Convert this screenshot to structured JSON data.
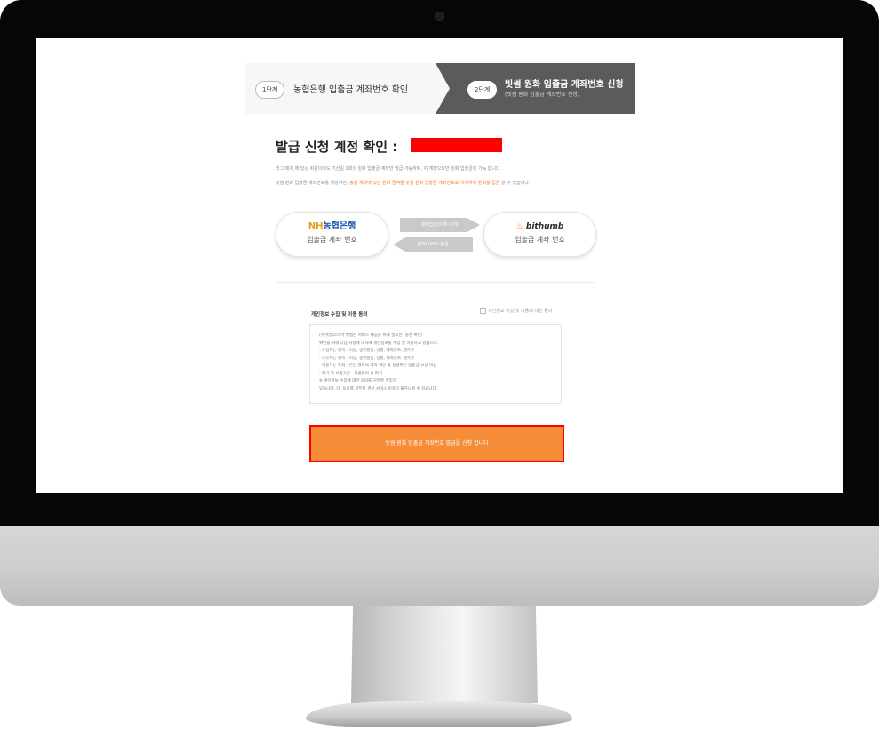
{
  "steps": {
    "step1": {
      "badge": "1단계",
      "label": "농협은행 입출금 계좌번호 확인"
    },
    "step2": {
      "badge": "2단계",
      "title": "빗썸 원화 입출금 계좌번호 신청",
      "subtitle": "(빗썸 원화 입출금 계좌번호 신청)"
    }
  },
  "heading": {
    "title": "발급 신청 계정 확인 :"
  },
  "description": {
    "line1": "리그 매치 에 있는 회원이라도 기산일 1회의 원화 입출금 계좌만 발급 가능하며, 이 계정으로만 원화 입출금이 가능 합니다.",
    "line2_prefix": "빗썸 원화 입출금 계좌번호를 생성하면,",
    "line2_highlight": "농협 계좌에 있는 원화 금액을 빗썸 원화 입출금 계좌번호로 이체하여 원화를 입금",
    "line2_suffix": "할 수 있습니다."
  },
  "flow": {
    "nh": {
      "logo_prefix": "NH",
      "logo_name": "농협은행",
      "label": "입출금 계좌 번호"
    },
    "bithumb": {
      "logo_icon": "flame-icon",
      "logo_name": "bithumb",
      "label": "입출금 계좌 번호"
    },
    "arrow_deposit": "원화입금(이체 미처)",
    "arrow_withdraw": "원화(KRW) 출금"
  },
  "agreement": {
    "title": "개인정보 수집 및 이용 동의",
    "checkbox_label": "개인정보 수집 및 이용에 대한 동의",
    "lines": [
      "(주)빗썸코리아 빗썸은 서비스 제공을 위해 필요한 (실명 확인)",
      "확인을 위해 다음 사항에 대하여 개인정보를 수집 및 이용하고 있습니다.",
      "- 수집하는 항목 : 이름, 생년월일, 성별, 계좌번호, 핸드폰",
      "- 보유하는 항목 : 이름, 생년월일, 성별, 계좌번호, 핸드폰",
      "- 이용하는 목적 : 본인 명의의 계좌 확인 및 실명확인 입출금 보상 대상",
      "- 파기 및 보존기간 : 회원탈퇴 시 파기",
      "※ 개인정보 수집에 대한 동의를 거부할 권리가",
      "있습니다. 단, 동의를 거부할 경우 서비스 이용이 불가능할 수 있습니다."
    ]
  },
  "submit": {
    "label": "빗썸 원화 입출금 계좌번호 발급을 신청 합니다"
  },
  "colors": {
    "accent": "#f58c38",
    "redaction": "#ff0000",
    "step_active": "#5b5b5b"
  }
}
